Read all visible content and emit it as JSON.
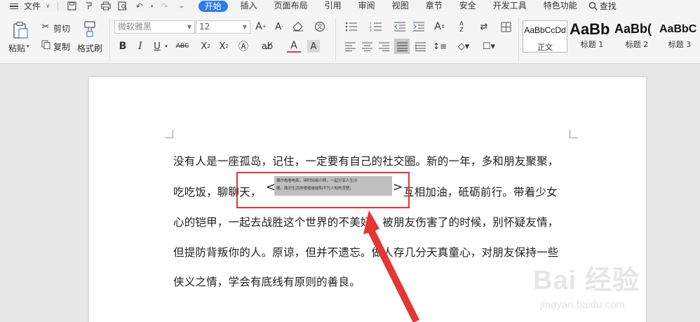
{
  "menubar": {
    "file_label": "文件",
    "tabs": [
      "开始",
      "插入",
      "页面布局",
      "引用",
      "审阅",
      "视图",
      "章节",
      "安全",
      "开发工具",
      "特色功能"
    ],
    "active_tab": "开始",
    "search_label": "查找"
  },
  "ribbon": {
    "paste_label": "粘贴",
    "cut_label": "剪切",
    "copy_label": "复制",
    "format_painter_label": "格式刷",
    "font_name": "微软雅黑",
    "font_size": "12",
    "styles": [
      {
        "sample": "AaBbCcDd",
        "label": "正文"
      },
      {
        "sample": "AaBb",
        "label": "标题 1"
      },
      {
        "sample": "AaBb(",
        "label": "标题 2"
      },
      {
        "sample": "AaBbC",
        "label": "标题 3"
      }
    ]
  },
  "document": {
    "line1": "没有人是一座孤岛，记住，一定要有自己的社交圈。新的一年，多和朋友聚聚，",
    "line2_before": "吃吃饭，聊聊天，",
    "line2_after": "互相加油，砥砺前行。带着少女",
    "bracket_left": "<",
    "bracket_right": ">",
    "annotation_line1": "偶尔看看电影，闲时拍拍小照，一起分享人生冷",
    "annotation_line2": "暖。面对生活的嗑嗑碰碰和不为人知的苦楚，",
    "line3": "心的铠甲，一起去战胜这个世界的不美好。被朋友伤害了的时候，别怀疑友情，",
    "line4": "但提防背叛你的人。原谅，但并不遗忘。做人存几分天真童心，对朋友保持一些",
    "line5": "侠义之情，学会有底线有原则的善良。"
  },
  "annotation_colors": {
    "highlight_border": "#e53535",
    "arrow": "#e53535",
    "shrunk_text_bg": "#bfbfbf",
    "active_tab_bg": "#2d7ce8"
  },
  "watermark": {
    "main": "Bai 经验",
    "sub": "jingyan.baidu.com"
  }
}
